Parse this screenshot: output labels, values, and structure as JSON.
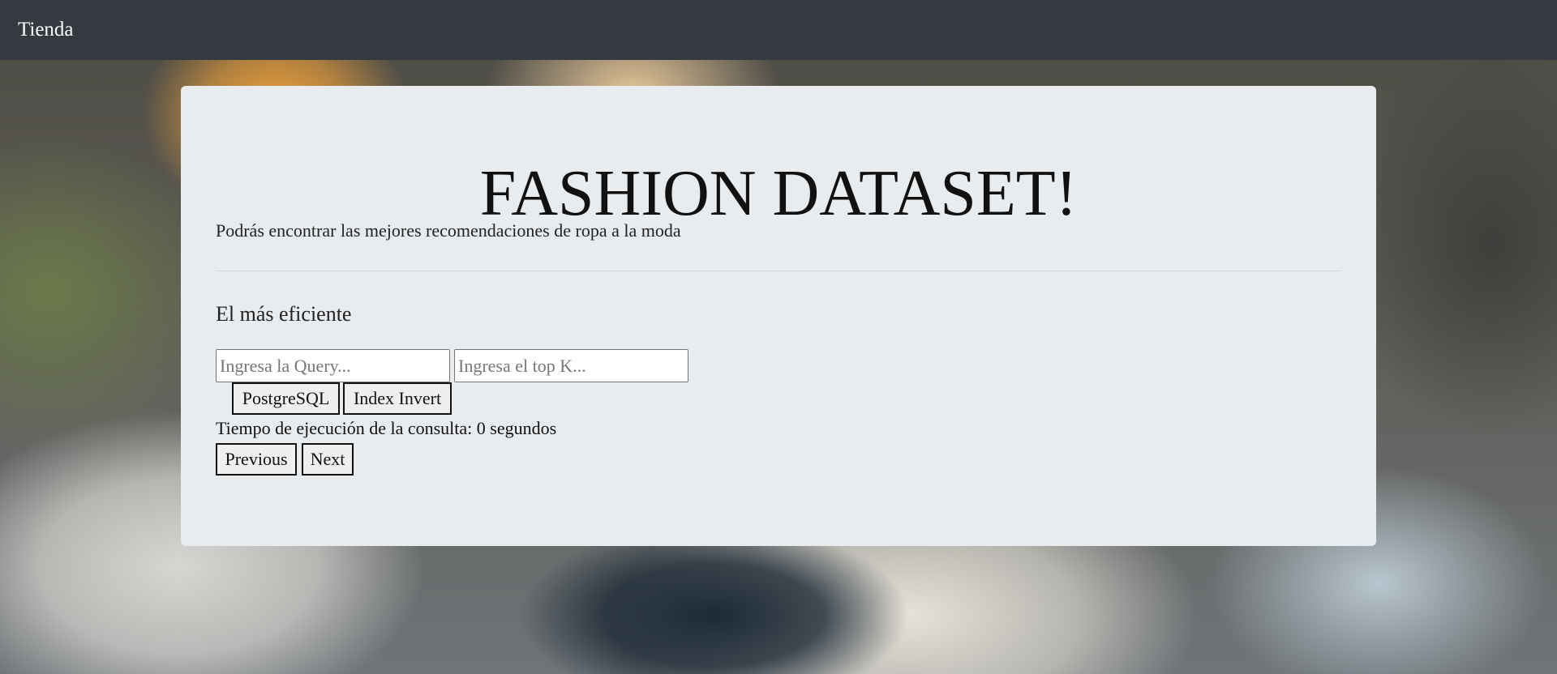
{
  "navbar": {
    "brand": "Tienda"
  },
  "hero": {
    "title": "FASHION DATASET!",
    "lead": "Podrás encontrar las mejores recomendaciones de ropa a la moda",
    "subtitle": "El más eficiente"
  },
  "search": {
    "query_placeholder": "Ingresa la Query...",
    "query_value": "",
    "topk_placeholder": "Ingresa el top K...",
    "topk_value": ""
  },
  "actions": {
    "postgres_label": "PostgreSQL",
    "index_label": "Index Invert"
  },
  "status": {
    "time_text": "Tiempo de ejecución de la consulta: 0 segundos"
  },
  "pagination": {
    "previous_label": "Previous",
    "next_label": "Next"
  }
}
